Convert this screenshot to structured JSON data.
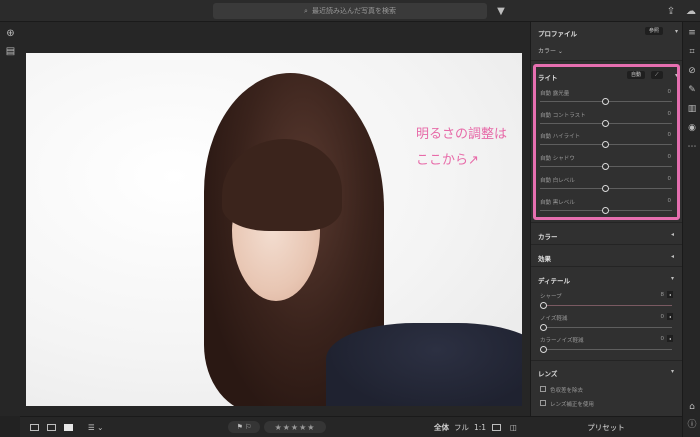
{
  "search": {
    "placeholder": "最近読み込んだ写真を検索"
  },
  "annotation": {
    "line1": "明るさの調整は",
    "line2": "ここから↗"
  },
  "panel": {
    "profile": {
      "title": "プロファイル",
      "browse": "参照",
      "mode": "カラー"
    },
    "light": {
      "title": "ライト",
      "auto": "自動",
      "sliders": [
        {
          "label": "自動 露光量",
          "value": "0"
        },
        {
          "label": "自動 コントラスト",
          "value": "0"
        },
        {
          "label": "自動 ハイライト",
          "value": "0"
        },
        {
          "label": "自動 シャドウ",
          "value": "0"
        },
        {
          "label": "自動 白レベル",
          "value": "0"
        },
        {
          "label": "自動 黒レベル",
          "value": "0"
        }
      ]
    },
    "color": {
      "title": "カラー"
    },
    "effects": {
      "title": "効果"
    },
    "detail": {
      "title": "ディテール",
      "sliders": [
        {
          "label": "シャープ",
          "value": "8"
        },
        {
          "label": "ノイズ軽減",
          "value": "0"
        },
        {
          "label": "カラーノイズ軽減",
          "value": "0"
        }
      ]
    },
    "lens": {
      "title": "レンズ",
      "checks": [
        "色収差を除去",
        "レンズ補正を使用"
      ]
    },
    "preset": "プリセット"
  },
  "bottom": {
    "view_all": "全体",
    "view_full": "フル",
    "ratio": "1:1",
    "stars": "★★★★★"
  }
}
